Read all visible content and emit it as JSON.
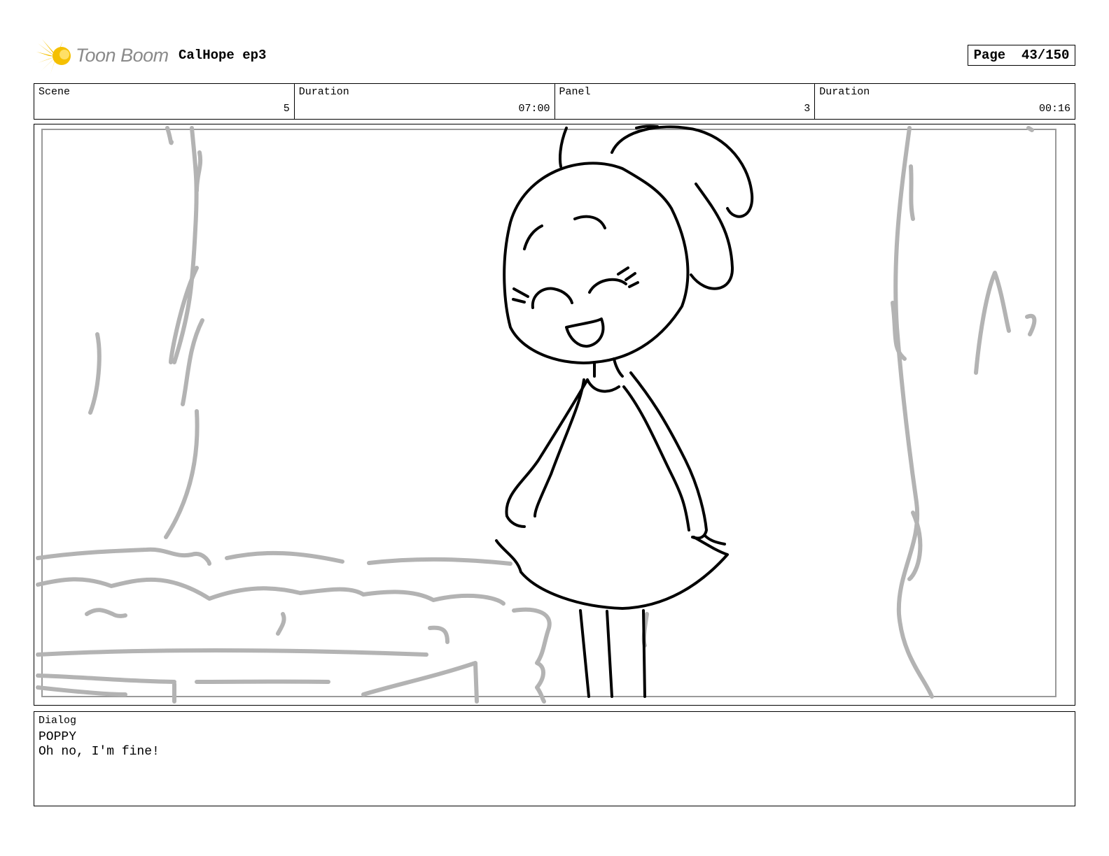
{
  "header": {
    "logo_text": "Toon Boom",
    "project_title": "CalHope ep3",
    "page_label": "Page",
    "page_value": "43/150"
  },
  "info": {
    "scene_label": "Scene",
    "scene_value": "5",
    "scene_duration_label": "Duration",
    "scene_duration_value": "07:00",
    "panel_label": "Panel",
    "panel_value": "3",
    "panel_duration_label": "Duration",
    "panel_duration_value": "00:16"
  },
  "dialog": {
    "label": "Dialog",
    "speaker": "POPPY",
    "line": "Oh no, I'm fine!"
  },
  "colors": {
    "logo_yellow": "#f5c000",
    "logo_text": "#8a8a8a",
    "sketch_gray": "#b3b3b3",
    "ink": "#000000"
  }
}
